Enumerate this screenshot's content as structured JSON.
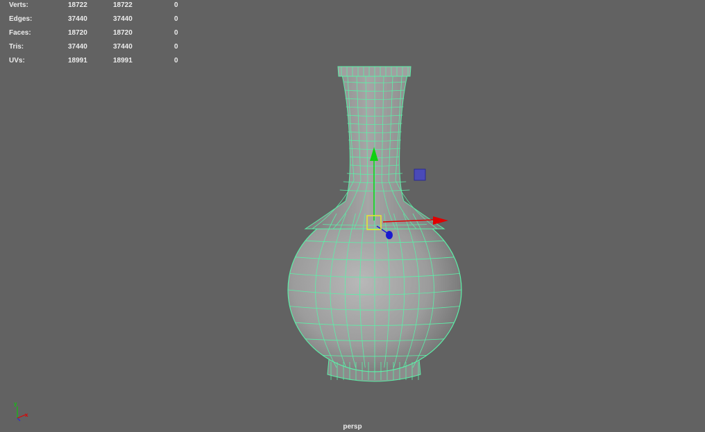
{
  "stats": [
    {
      "label": "Verts:",
      "values": [
        "18722",
        "18722",
        "0"
      ]
    },
    {
      "label": "Edges:",
      "values": [
        "37440",
        "37440",
        "0"
      ]
    },
    {
      "label": "Faces:",
      "values": [
        "18720",
        "18720",
        "0"
      ]
    },
    {
      "label": "Tris:",
      "values": [
        "37440",
        "37440",
        "0"
      ]
    },
    {
      "label": "UVs:",
      "values": [
        "18991",
        "18991",
        "0"
      ]
    }
  ],
  "camera": {
    "name": "persp"
  },
  "axis_indicator": {
    "y_label": "y",
    "x_label": "x"
  },
  "colors": {
    "background": "#626262",
    "hud_text": "#ececec",
    "wireframe": "#5cf0a8",
    "mesh_shade": "#9a9a9a",
    "gizmo_x": "#e00000",
    "gizmo_y": "#10d010",
    "gizmo_z": "#1a1ad0",
    "pivot": "#e8e830",
    "plane_handle": "#4a4ab8"
  }
}
